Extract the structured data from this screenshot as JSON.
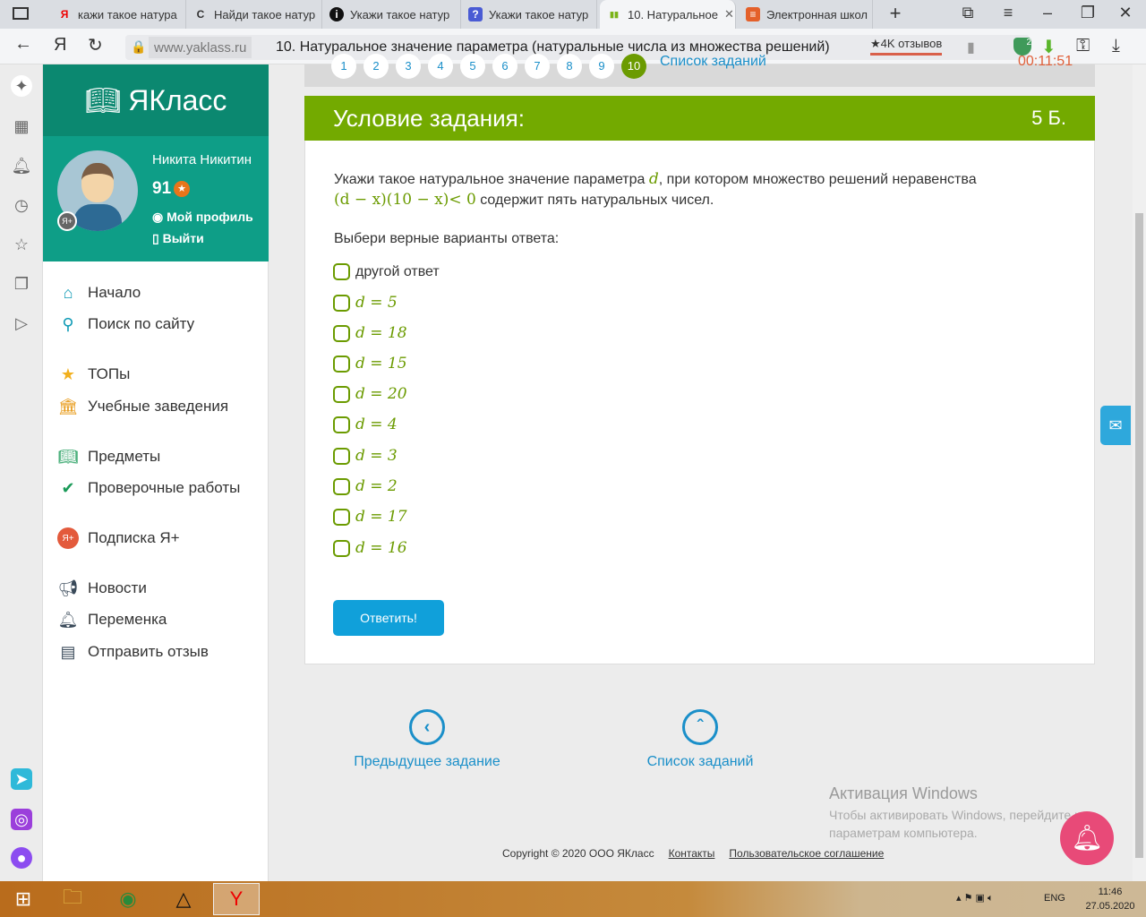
{
  "browser": {
    "tabs": [
      {
        "icon": "Я",
        "label": "кажи такое натура"
      },
      {
        "icon": "C",
        "label": "Найди такое натур"
      },
      {
        "icon": "i",
        "label": "Укажи такое натур"
      },
      {
        "icon": "?",
        "label": "Укажи такое натур"
      },
      {
        "icon": "▮▮",
        "label": "10. Натуральное"
      },
      {
        "icon": "≡",
        "label": "Электронная школ"
      }
    ],
    "url_domain": "www.yaklass.ru",
    "page_title": "10. Натуральное значение параметра (натуральные числа из множества решений)",
    "reviews": "★4K отзывов",
    "shield_count": "2"
  },
  "site": {
    "logo": "ЯКласс",
    "user": {
      "name": "Никита Никитин",
      "points": "91",
      "profile": "Мой профиль",
      "logout": "Выйти",
      "badge": "Я+"
    },
    "nav": [
      "Начало",
      "Поиск по сайту",
      "ТОПы",
      "Учебные заведения",
      "Предметы",
      "Проверочные работы",
      "Подписка Я+",
      "Новости",
      "Переменка",
      "Отправить отзыв"
    ]
  },
  "pager": {
    "pages": [
      "1",
      "2",
      "3",
      "4",
      "5",
      "6",
      "7",
      "8",
      "9",
      "10"
    ],
    "list_link": "Список заданий",
    "timer": "00:11:51"
  },
  "task": {
    "header": "Условие задания:",
    "points": "5 Б.",
    "text1": "Укажи такое натуральное значение параметра ",
    "param": "d",
    "text2": ", при котором множество решений неравенства",
    "inequality": "(d − x)(10 − x)< 0",
    "text3": " содержит пять натуральных чисел.",
    "prompt": "Выбери верные варианты ответа:",
    "options": [
      "другой ответ",
      "d = 5",
      "d = 18",
      "d = 15",
      "d = 20",
      "d = 4",
      "d = 3",
      "d = 2",
      "d = 17",
      "d = 16"
    ],
    "submit": "Ответить!"
  },
  "links": {
    "prev": "Предыдущее задание",
    "list": "Список заданий"
  },
  "footer": {
    "copyright": "Copyright © 2020 ООО ЯКласс",
    "contacts": "Контакты",
    "agreement": "Пользовательское соглашение"
  },
  "watermark": {
    "title": "Активация Windows",
    "text": "Чтобы активировать Windows, перейдите к параметрам компьютера."
  },
  "taskbar": {
    "lang": "ENG",
    "time": "11:46",
    "date": "27.05.2020"
  },
  "colors": {
    "green": "#73aa00",
    "teal": "#0b8870",
    "blue": "#10a0da"
  }
}
